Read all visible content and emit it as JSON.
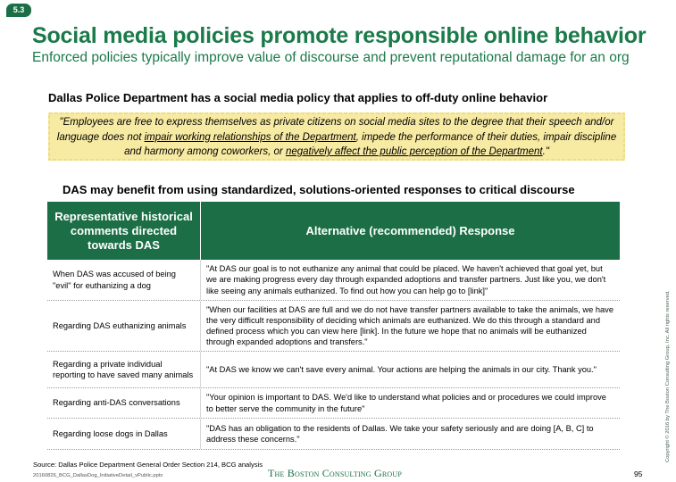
{
  "badge": "5.3",
  "title": "Social media policies promote responsible online behavior",
  "subtitle": "Enforced policies typically improve value of discourse and prevent reputational damage for an org",
  "policy_heading": "Dallas Police Department has a social media policy that applies to off-duty online behavior",
  "quote": {
    "part1": "\"Employees are free to express themselves as private citizens on social media sites to the degree that their speech and/or language does not ",
    "underline1": "impair working relationships of the Department",
    "part2": ", impede the performance of their duties, impair discipline and harmony among coworkers, or ",
    "underline2": "negatively affect the public perception of the Department",
    "part3": ".\""
  },
  "table_heading": "DAS may benefit from using standardized, solutions-oriented responses to critical discourse",
  "table": {
    "header_col1": "Representative historical comments directed towards DAS",
    "header_col2": "Alternative (recommended) Response",
    "rows": [
      {
        "comment": "When DAS was accused of being \"evil\" for euthanizing a dog",
        "response": "\"At DAS our goal is to not euthanize any animal that could be placed. We haven't achieved that goal yet, but we are making progress every day through expanded adoptions and transfer partners. Just like you, we don't like seeing any animals euthanized. To find out how you can help go to [link]\""
      },
      {
        "comment": "Regarding DAS euthanizing animals",
        "response": "\"When our facilities at DAS are full and we do not have transfer partners available to take the animals, we have the very difficult responsibility of deciding which animals are euthanized. We do this through a standard and defined process which you can view here [link]. In the future we hope that no animals will be euthanized through expanded adoptions and transfers.\""
      },
      {
        "comment": "Regarding a private individual reporting to have saved many animals",
        "response": "\"At DAS we know we can't save every animal. Your actions are helping the animals in our city. Thank you.\""
      },
      {
        "comment": "Regarding anti-DAS conversations",
        "response": "\"Your opinion is important to DAS. We'd like to understand what policies and or procedures we could improve to better serve the community in the future\""
      },
      {
        "comment": "Regarding loose dogs in Dallas",
        "response": "\"DAS has an obligation to the residents of Dallas. We take your safety seriously and are doing [A, B, C] to address these concerns.\""
      }
    ]
  },
  "source": "Source: Dallas Police Department General Order Section 214, BCG analysis",
  "filename": "20160826_BCG_DallasDog_InitiativeDetail_vPublic.pptx",
  "logo": "The Boston Consulting Group",
  "page_number": "95",
  "copyright": "Copyright © 2016 by The Boston Consulting Group, Inc. All rights reserved.",
  "colors": {
    "accent_green": "#1b7a4a",
    "header_green": "#1b6e45",
    "quote_highlight": "#f7eaa3"
  }
}
